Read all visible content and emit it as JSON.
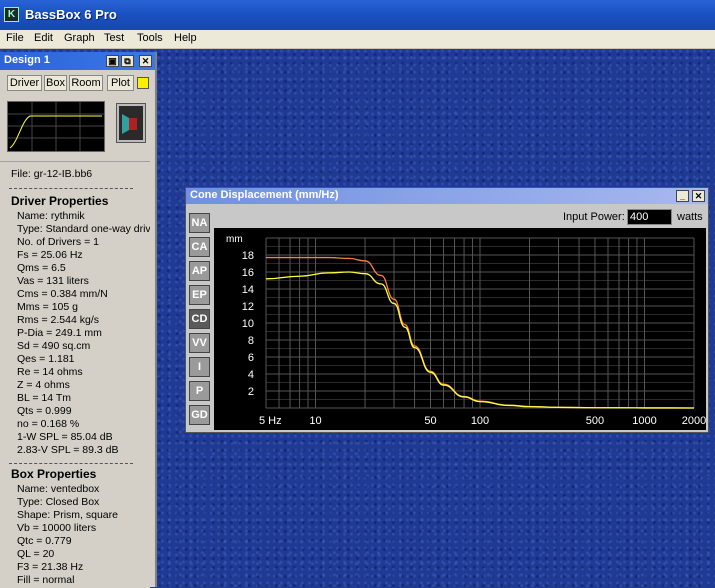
{
  "app": {
    "title": "BassBox 6 Pro",
    "icon": "K"
  },
  "menu": [
    "File",
    "Edit",
    "Graph",
    "Test",
    "Tools",
    "Help"
  ],
  "design": {
    "title": "Design 1",
    "tabs": [
      "Driver",
      "Box",
      "Room",
      "Plot"
    ],
    "file": "File: gr-12-IB.bb6",
    "driver_heading": "Driver Properties",
    "driver": [
      "Name: rythmik",
      "Type: Standard one-way driv",
      "No. of Drivers = 1",
      "Fs = 25.06 Hz",
      "Qms = 6.5",
      "Vas = 131 liters",
      "Cms = 0.384 mm/N",
      "Mms = 105 g",
      "Rms = 2.544 kg/s",
      "P-Dia = 249.1 mm",
      "Sd = 490 sq.cm",
      "Qes = 1.181",
      "Re = 14 ohms",
      "Z = 4 ohms",
      "BL = 14 Tm",
      "Qts = 0.999",
      "no = 0.168 %",
      "1-W SPL = 85.04 dB",
      "2.83-V SPL = 89.3 dB"
    ],
    "box_heading": "Box Properties",
    "box": [
      "Name: ventedbox",
      "Type: Closed Box",
      "Shape: Prism, square",
      "Vb = 10000 liters",
      "Qtc = 0.779",
      "QL = 20",
      "F3 = 21.38 Hz",
      "Fill = normal"
    ]
  },
  "cone_window": {
    "title": "Cone Displacement (mm/Hz)",
    "input_power_label": "Input Power:",
    "input_power_value": "400",
    "input_power_unit": "watts",
    "side_buttons": [
      "NA",
      "CA",
      "AP",
      "EP",
      "CD",
      "VV",
      "I",
      "P",
      "GD"
    ],
    "active_button": "CD"
  },
  "colors": {
    "curve_orange": "#ff7f3f",
    "curve_yellow": "#ffff40",
    "grid": "#555555",
    "plot_bg": "#000000"
  },
  "chart_data": {
    "type": "line",
    "ylabel": "mm",
    "xscale": "log",
    "xlim": [
      5,
      2000
    ],
    "ylim": [
      0,
      20
    ],
    "x_ticks": [
      {
        "value": 5,
        "label": "5 Hz"
      },
      {
        "value": 10,
        "label": "10"
      },
      {
        "value": 50,
        "label": "50"
      },
      {
        "value": 100,
        "label": "100"
      },
      {
        "value": 500,
        "label": "500"
      },
      {
        "value": 1000,
        "label": "1000"
      },
      {
        "value": 2000,
        "label": "2000"
      }
    ],
    "y_ticks": [
      2,
      4,
      6,
      8,
      10,
      12,
      14,
      16,
      18
    ],
    "series": [
      {
        "color": "#ff7f3f",
        "x": [
          5,
          8,
          12,
          16,
          20,
          25,
          30,
          35,
          40,
          50,
          60,
          80,
          100,
          150,
          200,
          300,
          500,
          1000,
          2000
        ],
        "y": [
          17.7,
          17.7,
          17.7,
          17.6,
          17.3,
          15.6,
          12.8,
          9.8,
          7.3,
          4.3,
          2.8,
          1.35,
          0.8,
          0.33,
          0.18,
          0.08,
          0.03,
          0.01,
          0.0
        ]
      },
      {
        "color": "#ffff40",
        "x": [
          5,
          8,
          12,
          16,
          20,
          25,
          30,
          35,
          40,
          50,
          60,
          80,
          100,
          150,
          200,
          300,
          500,
          1000,
          2000
        ],
        "y": [
          15.2,
          15.5,
          15.9,
          16.0,
          15.8,
          14.6,
          12.3,
          9.5,
          7.1,
          4.2,
          2.7,
          1.3,
          0.75,
          0.3,
          0.16,
          0.07,
          0.03,
          0.01,
          0.0
        ]
      }
    ]
  }
}
